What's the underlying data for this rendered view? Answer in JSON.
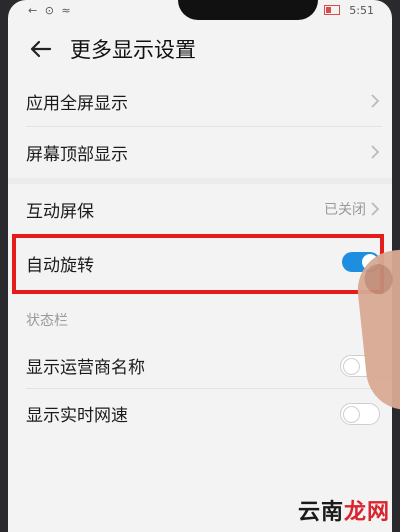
{
  "status_bar": {
    "left_icons": "← ⊙ ≈",
    "time": "5:51"
  },
  "header": {
    "title": "更多显示设置"
  },
  "items": [
    {
      "label": "应用全屏显示"
    },
    {
      "label": "屏幕顶部显示"
    },
    {
      "label": "互动屏保",
      "value": "已关闭"
    },
    {
      "label": "自动旋转",
      "toggle": true
    },
    {
      "label": "显示运营商名称",
      "toggle": false
    },
    {
      "label": "显示实时网速",
      "toggle": false
    }
  ],
  "section": {
    "status_bar_title": "状态栏"
  },
  "watermark": {
    "prefix": "云南",
    "accent": "龙网"
  },
  "colors": {
    "toggle_on": "#1e8fe0",
    "highlight": "#e41c1c"
  }
}
